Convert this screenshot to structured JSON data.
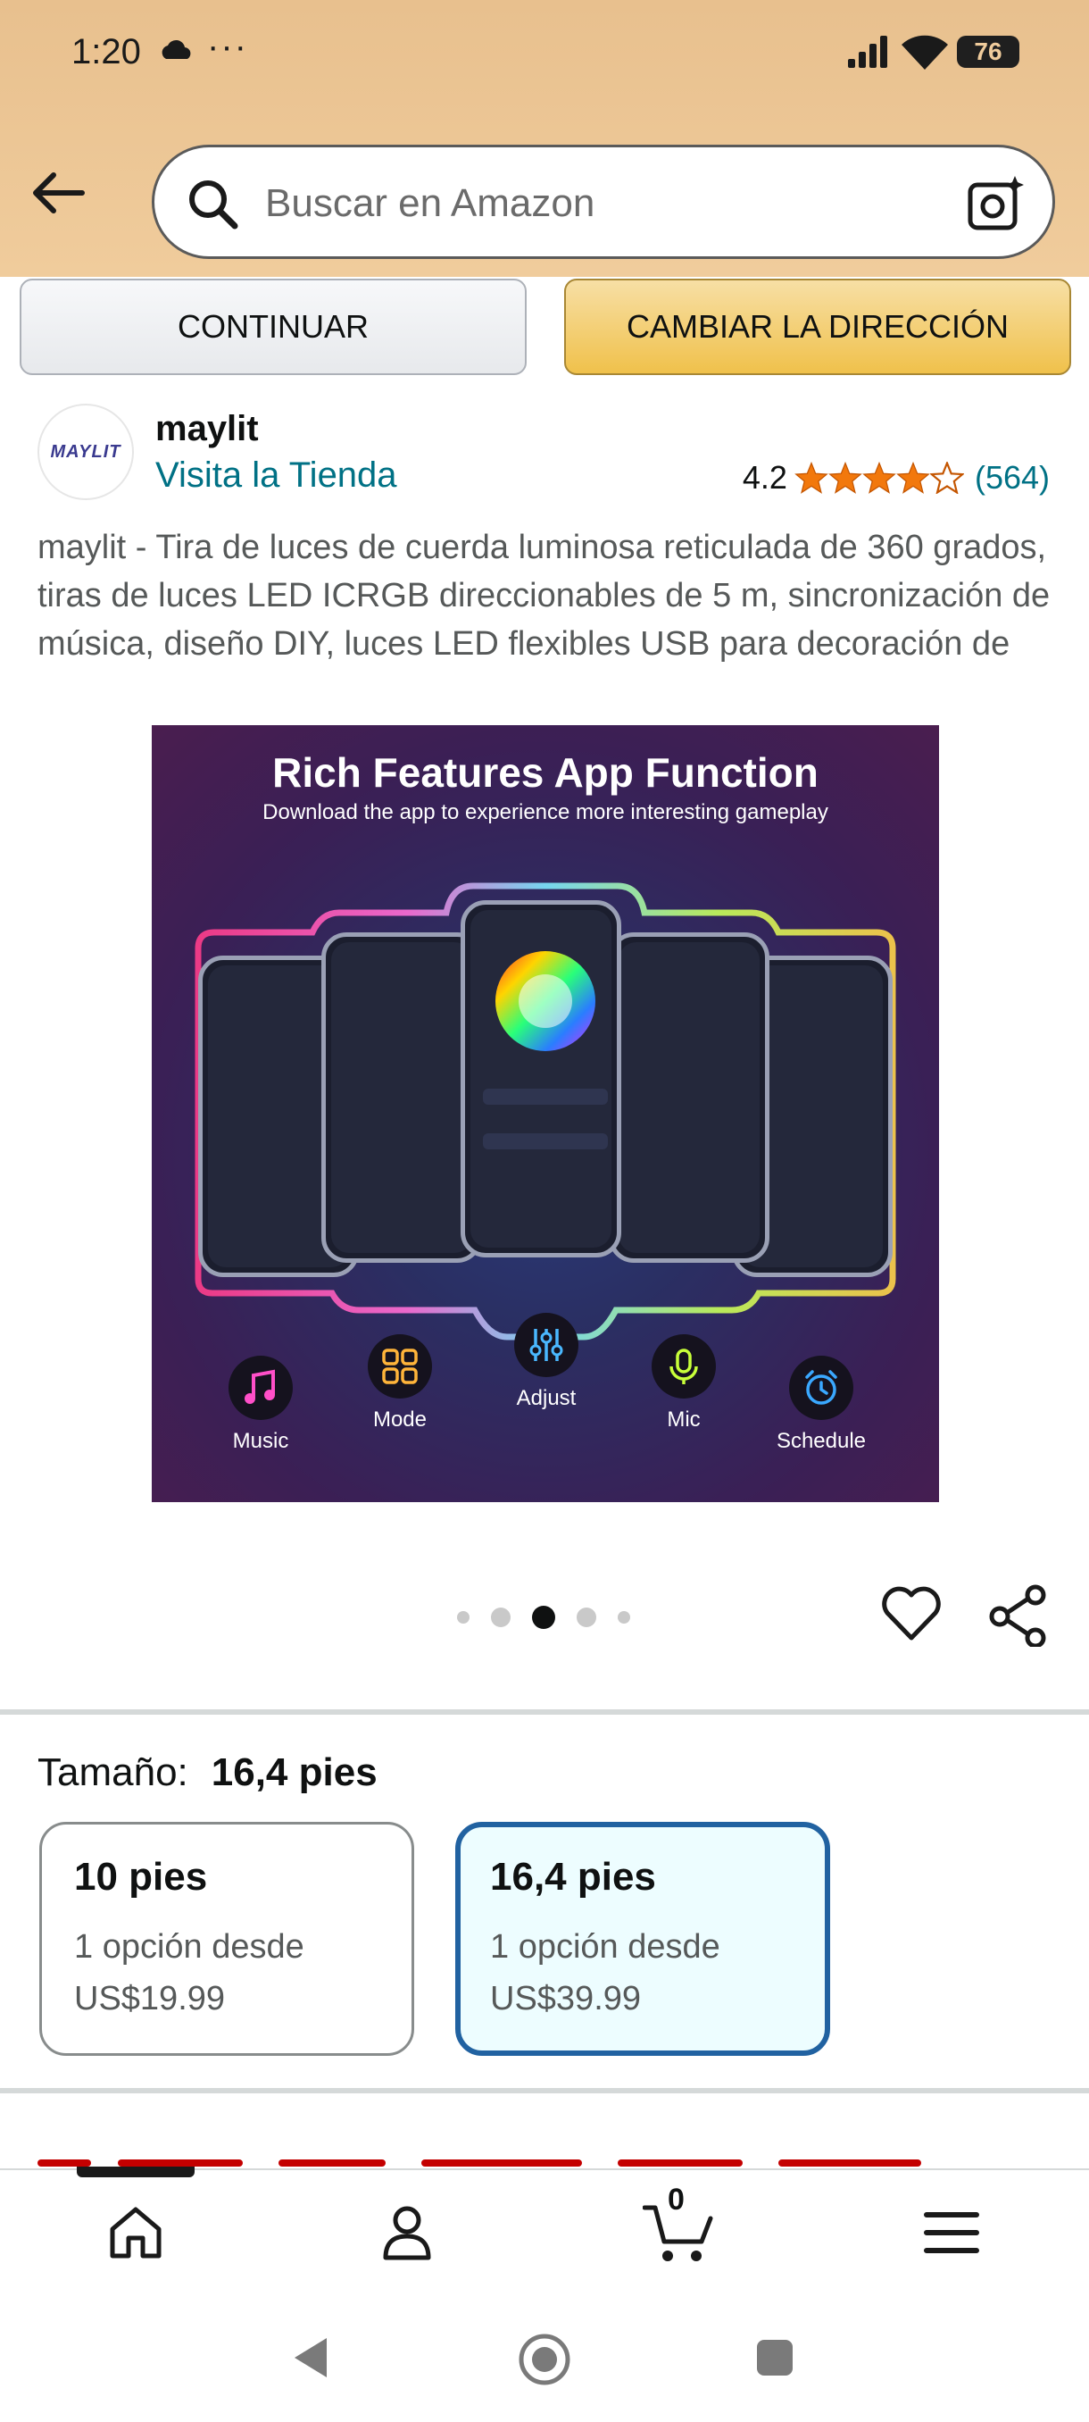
{
  "status_bar": {
    "time": "1:20",
    "dots": "···",
    "battery": "76"
  },
  "header": {
    "search_placeholder": "Buscar en Amazon"
  },
  "address_buttons": {
    "continue": "CONTINUAR",
    "change": "CAMBIAR LA DIRECCIÓN"
  },
  "brand": {
    "logo_text": "MAYLIT",
    "name": "maylit",
    "store_link": "Visita la Tienda"
  },
  "rating": {
    "value": "4.2",
    "stars": 4.2,
    "count": "(564)"
  },
  "product_title": "maylit - Tira de luces de cuerda luminosa reticulada de 360 grados, tiras de luces LED ICRGB direccionables de 5 m, sincronización de música, diseño DIY, luces LED flexibles USB para decoración de",
  "product_image": {
    "headline": "Rich Features App Function",
    "subline": "Download the app to experience more interesting gameplay",
    "features": [
      "Music",
      "Mode",
      "Adjust",
      "Mic",
      "Schedule"
    ]
  },
  "carousel": {
    "count": 5,
    "active": 2
  },
  "size": {
    "label": "Tamaño:",
    "selected": "16,4 pies",
    "options": [
      {
        "size": "10 pies",
        "line1": "1 opción desde",
        "price": "US$19.99",
        "selected": false
      },
      {
        "size": "16,4 pies",
        "line1": "1 opción desde",
        "price": "US$39.99",
        "selected": true
      }
    ]
  },
  "bottom_nav": {
    "cart_count": "0",
    "items": [
      "home-icon",
      "account-icon",
      "cart-icon",
      "menu-icon"
    ]
  },
  "colors": {
    "amazon_link": "#007185",
    "star": "#f2780c",
    "selected_border": "#2162a1",
    "header_bg": "#f0cc9c"
  }
}
